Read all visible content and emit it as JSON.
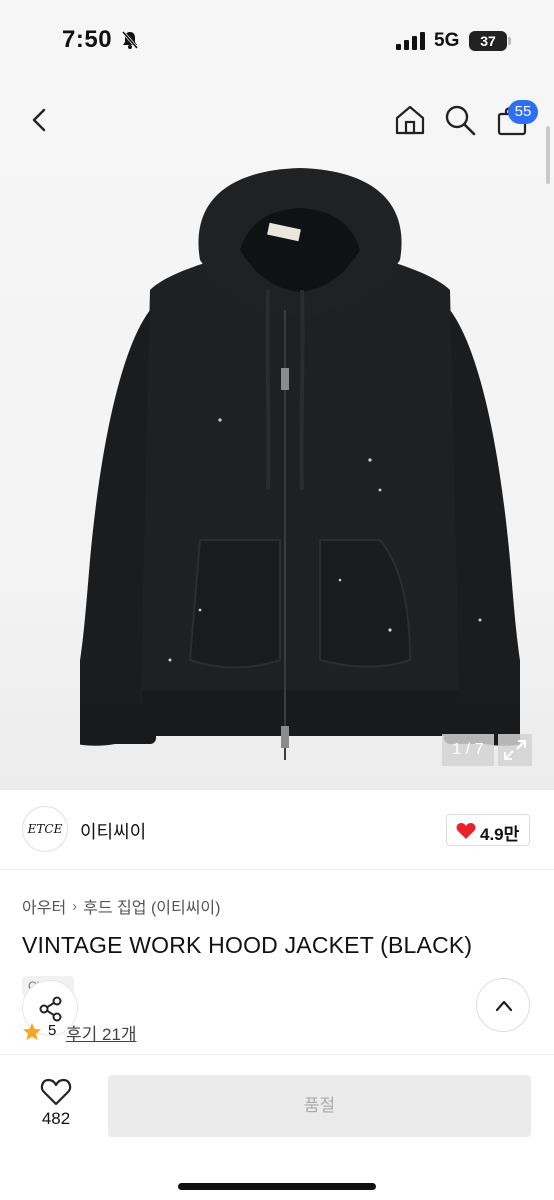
{
  "status_bar": {
    "time": "7:50",
    "network": "5G",
    "battery": "37"
  },
  "nav": {
    "cart_count": "55"
  },
  "gallery": {
    "counter": "1 / 7",
    "image_brand_label": "ETCE"
  },
  "brand": {
    "logo_text": "ETCE",
    "name": "이티씨이",
    "likes": "4.9만"
  },
  "product": {
    "breadcrumb": [
      "아우터",
      "후드 집업 (이티씨이)"
    ],
    "title": "VINTAGE WORK HOOD JACKET (BLACK)",
    "tag": "Cl...al",
    "rating": "5",
    "review_link": "후기 21개"
  },
  "bottom_bar": {
    "wish_count": "482",
    "purchase_label": "품절"
  },
  "colors": {
    "accent_blue": "#2b6ff2",
    "heart_red": "#e8212a",
    "star_orange": "#f5a623",
    "disabled_button": "#ebebeb"
  }
}
